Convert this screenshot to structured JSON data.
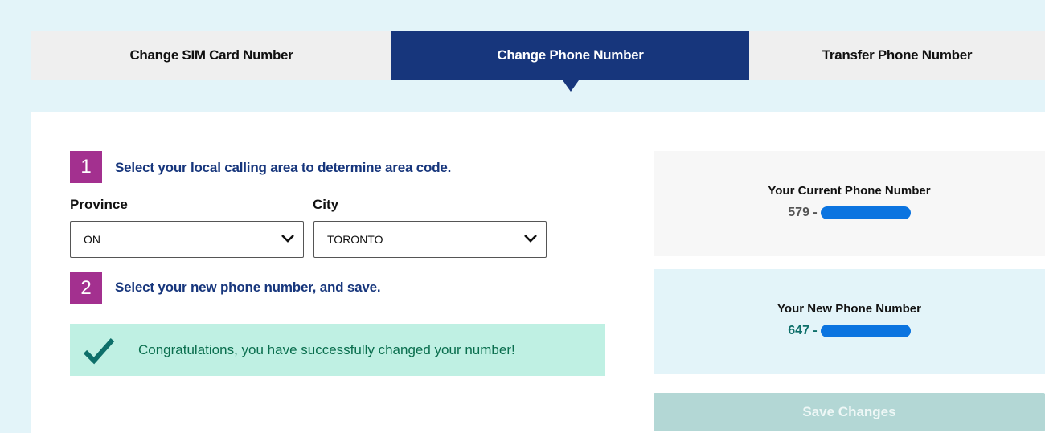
{
  "tabs": [
    {
      "label": "Change SIM Card Number"
    },
    {
      "label": "Change Phone Number"
    },
    {
      "label": "Transfer Phone Number"
    }
  ],
  "active_tab": "Change Phone Number",
  "step1": {
    "number": "1",
    "text": "Select your local calling area to determine area code."
  },
  "province": {
    "label": "Province",
    "value": "ON"
  },
  "city": {
    "label": "City",
    "value": "TORONTO"
  },
  "step2": {
    "number": "2",
    "text": "Select your new phone number, and save."
  },
  "success_message": "Congratulations, you have successfully changed your number!",
  "current_number": {
    "title": "Your Current Phone Number",
    "prefix": "579 -"
  },
  "new_number": {
    "title": "Your New Phone Number",
    "prefix": "647 -"
  },
  "save_label": "Save Changes",
  "colors": {
    "active_tab": "#17367c",
    "step_badge": "#a3308f",
    "success_bg": "#bff0e3",
    "success_text": "#0a6e4e",
    "save_disabled": "#b3d7d5"
  }
}
